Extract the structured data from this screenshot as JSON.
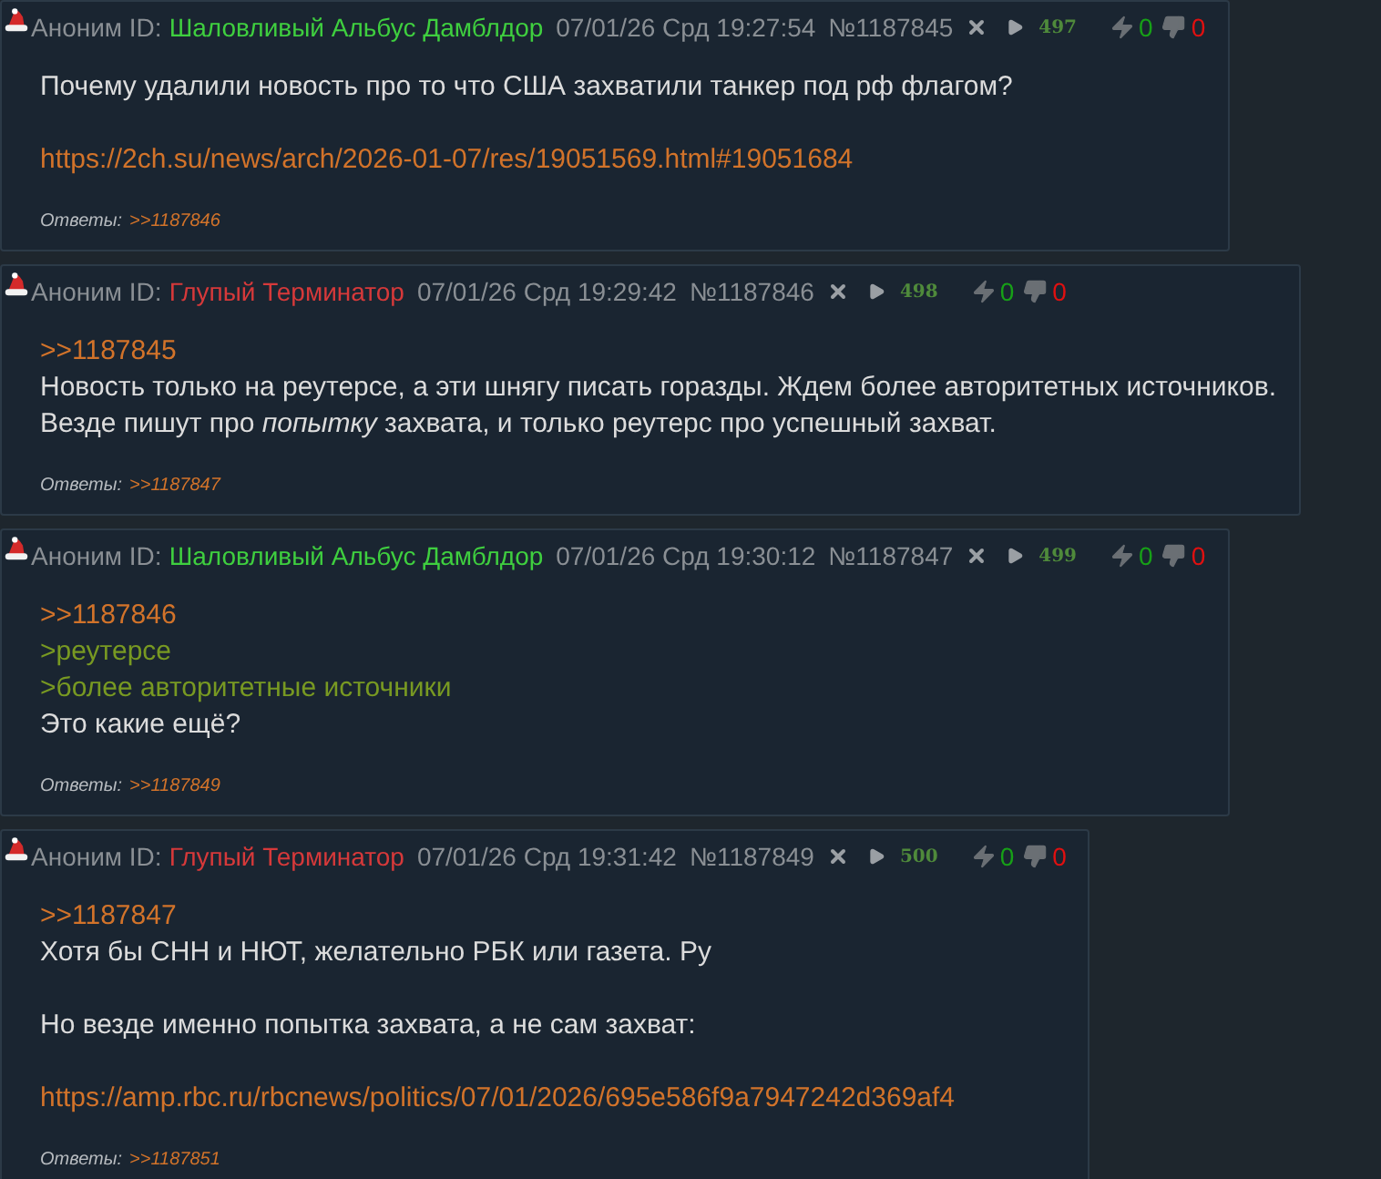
{
  "posts": [
    {
      "author_label": "Аноним ID:",
      "name": "Шаловливый Альбус Дамблдор",
      "color": "#3fcf3f",
      "date": "07/01/26 Срд 19:27:54",
      "number": "№1187845",
      "count": "497",
      "likes": "0",
      "dislikes": "0",
      "lines": [
        {
          "kind": "text",
          "text": "Почему удалили новость про то что США захватили танкер под рф флагом?"
        },
        {
          "kind": "blank"
        },
        {
          "kind": "link",
          "text": "https://2ch.su/news/arch/2026-01-07/res/19051569.html#19051684"
        }
      ],
      "replies_label": "Ответы:",
      "replies": [
        ">>1187846"
      ]
    },
    {
      "author_label": "Аноним ID:",
      "name": "Глупый Терминатор",
      "color": "#d6393a",
      "date": "07/01/26 Срд 19:29:42",
      "number": "№1187846",
      "count": "498",
      "likes": "0",
      "dislikes": "0",
      "lines": [
        {
          "kind": "link",
          "text": ">>1187845"
        },
        {
          "kind": "text",
          "text": "Новость только на реутерсе, а эти шнягу писать горазды. Ждем более авторитетных источников."
        },
        {
          "kind": "text",
          "text": "Везде пишут про *попытку* захвата, и только реутерс про успешный захват."
        }
      ],
      "replies_label": "Ответы:",
      "replies": [
        ">>1187847"
      ]
    },
    {
      "author_label": "Аноним ID:",
      "name": "Шаловливый Альбус Дамблдор",
      "color": "#3fcf3f",
      "date": "07/01/26 Срд 19:30:12",
      "number": "№1187847",
      "count": "499",
      "likes": "0",
      "dislikes": "0",
      "lines": [
        {
          "kind": "link",
          "text": ">>1187846"
        },
        {
          "kind": "quote",
          "text": ">реутерсе"
        },
        {
          "kind": "quote",
          "text": ">более авторитетные источники"
        },
        {
          "kind": "text",
          "text": "Это какие ещё?"
        }
      ],
      "replies_label": "Ответы:",
      "replies": [
        ">>1187849"
      ]
    },
    {
      "author_label": "Аноним ID:",
      "name": "Глупый Терминатор",
      "color": "#d6393a",
      "date": "07/01/26 Срд 19:31:42",
      "number": "№1187849",
      "count": "500",
      "likes": "0",
      "dislikes": "0",
      "lines": [
        {
          "kind": "link",
          "text": ">>1187847"
        },
        {
          "kind": "text",
          "text": "Хотя бы СНН и НЮТ, желательно РБК или газета. Ру"
        },
        {
          "kind": "blank"
        },
        {
          "kind": "text",
          "text": "Но везде именно попытка захвата, а не сам захват:"
        },
        {
          "kind": "blank"
        },
        {
          "kind": "link",
          "text": "https://amp.rbc.ru/rbcnews/politics/07/01/2026/695e586f9a7947242d369af4"
        }
      ],
      "replies_label": "Ответы:",
      "replies": [
        ">>1187851"
      ]
    }
  ]
}
